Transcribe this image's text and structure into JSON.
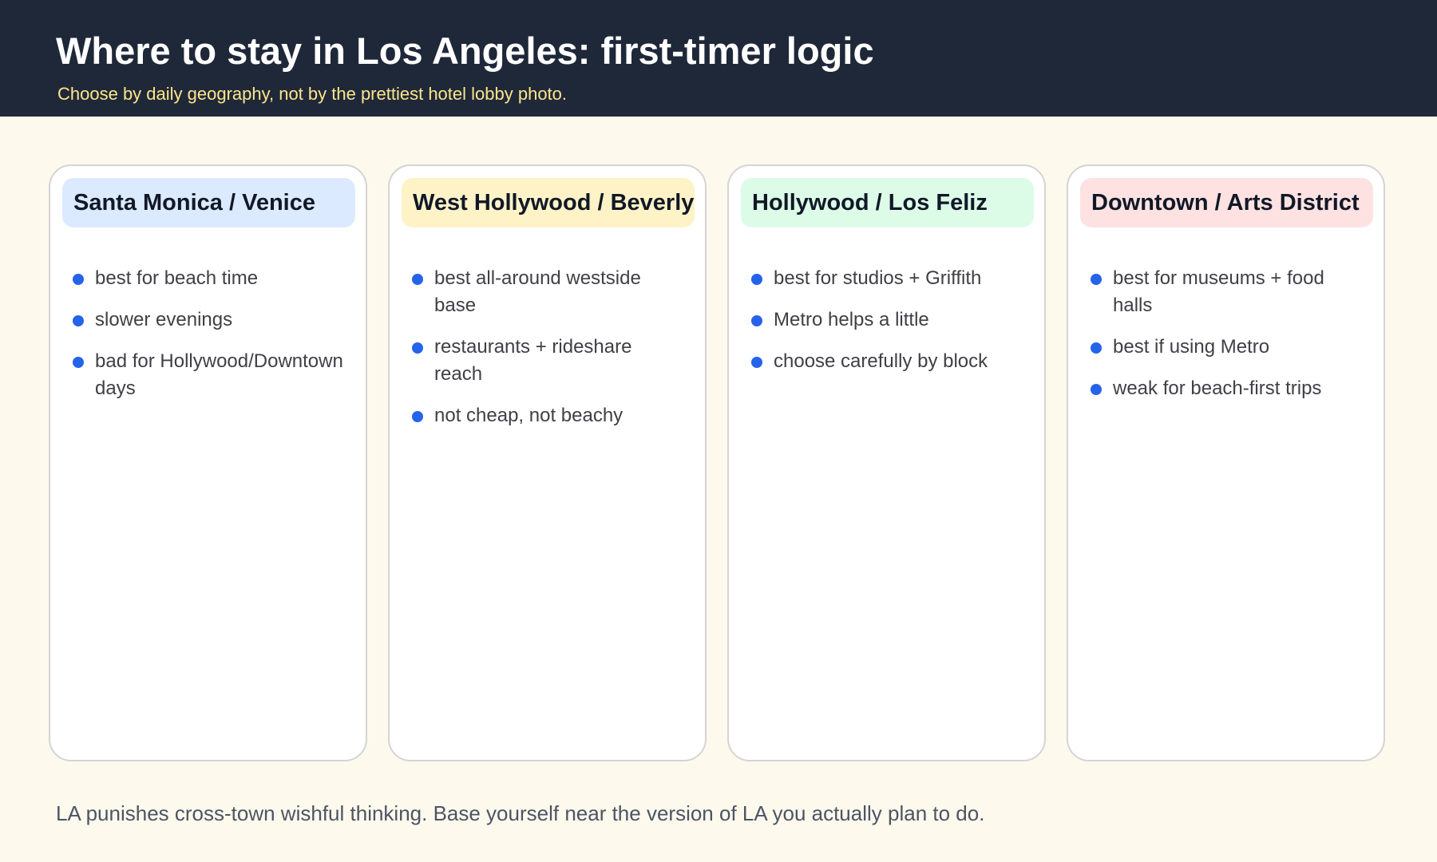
{
  "header": {
    "title": "Where to stay in Los Angeles: first-timer logic",
    "subtitle": "Choose by daily geography, not by the prettiest hotel lobby photo."
  },
  "cards": [
    {
      "title": "Santa Monica / Venice",
      "header_color": "#dbeafe",
      "bullets": [
        "best for beach time",
        "slower evenings",
        "bad for Hollywood/Downtown days"
      ]
    },
    {
      "title": "West Hollywood / Beverly Grove",
      "header_color": "#fef3c7",
      "bullets": [
        "best all-around westside base",
        "restaurants + rideshare reach",
        "not cheap, not beachy"
      ]
    },
    {
      "title": "Hollywood / Los Feliz",
      "header_color": "#dcfce7",
      "bullets": [
        "best for studios + Griffith",
        "Metro helps a little",
        "choose carefully by block"
      ]
    },
    {
      "title": "Downtown / Arts District",
      "header_color": "#fee2e2",
      "bullets": [
        "best for museums + food halls",
        "best if using Metro",
        "weak for beach-first trips"
      ]
    }
  ],
  "footer": {
    "note": "LA punishes cross-town wishful thinking. Base yourself near the version of LA you actually plan to do."
  },
  "colors": {
    "header_bg": "#1f2839",
    "accent_bullet": "#2563eb",
    "subtitle": "#fde68a"
  }
}
